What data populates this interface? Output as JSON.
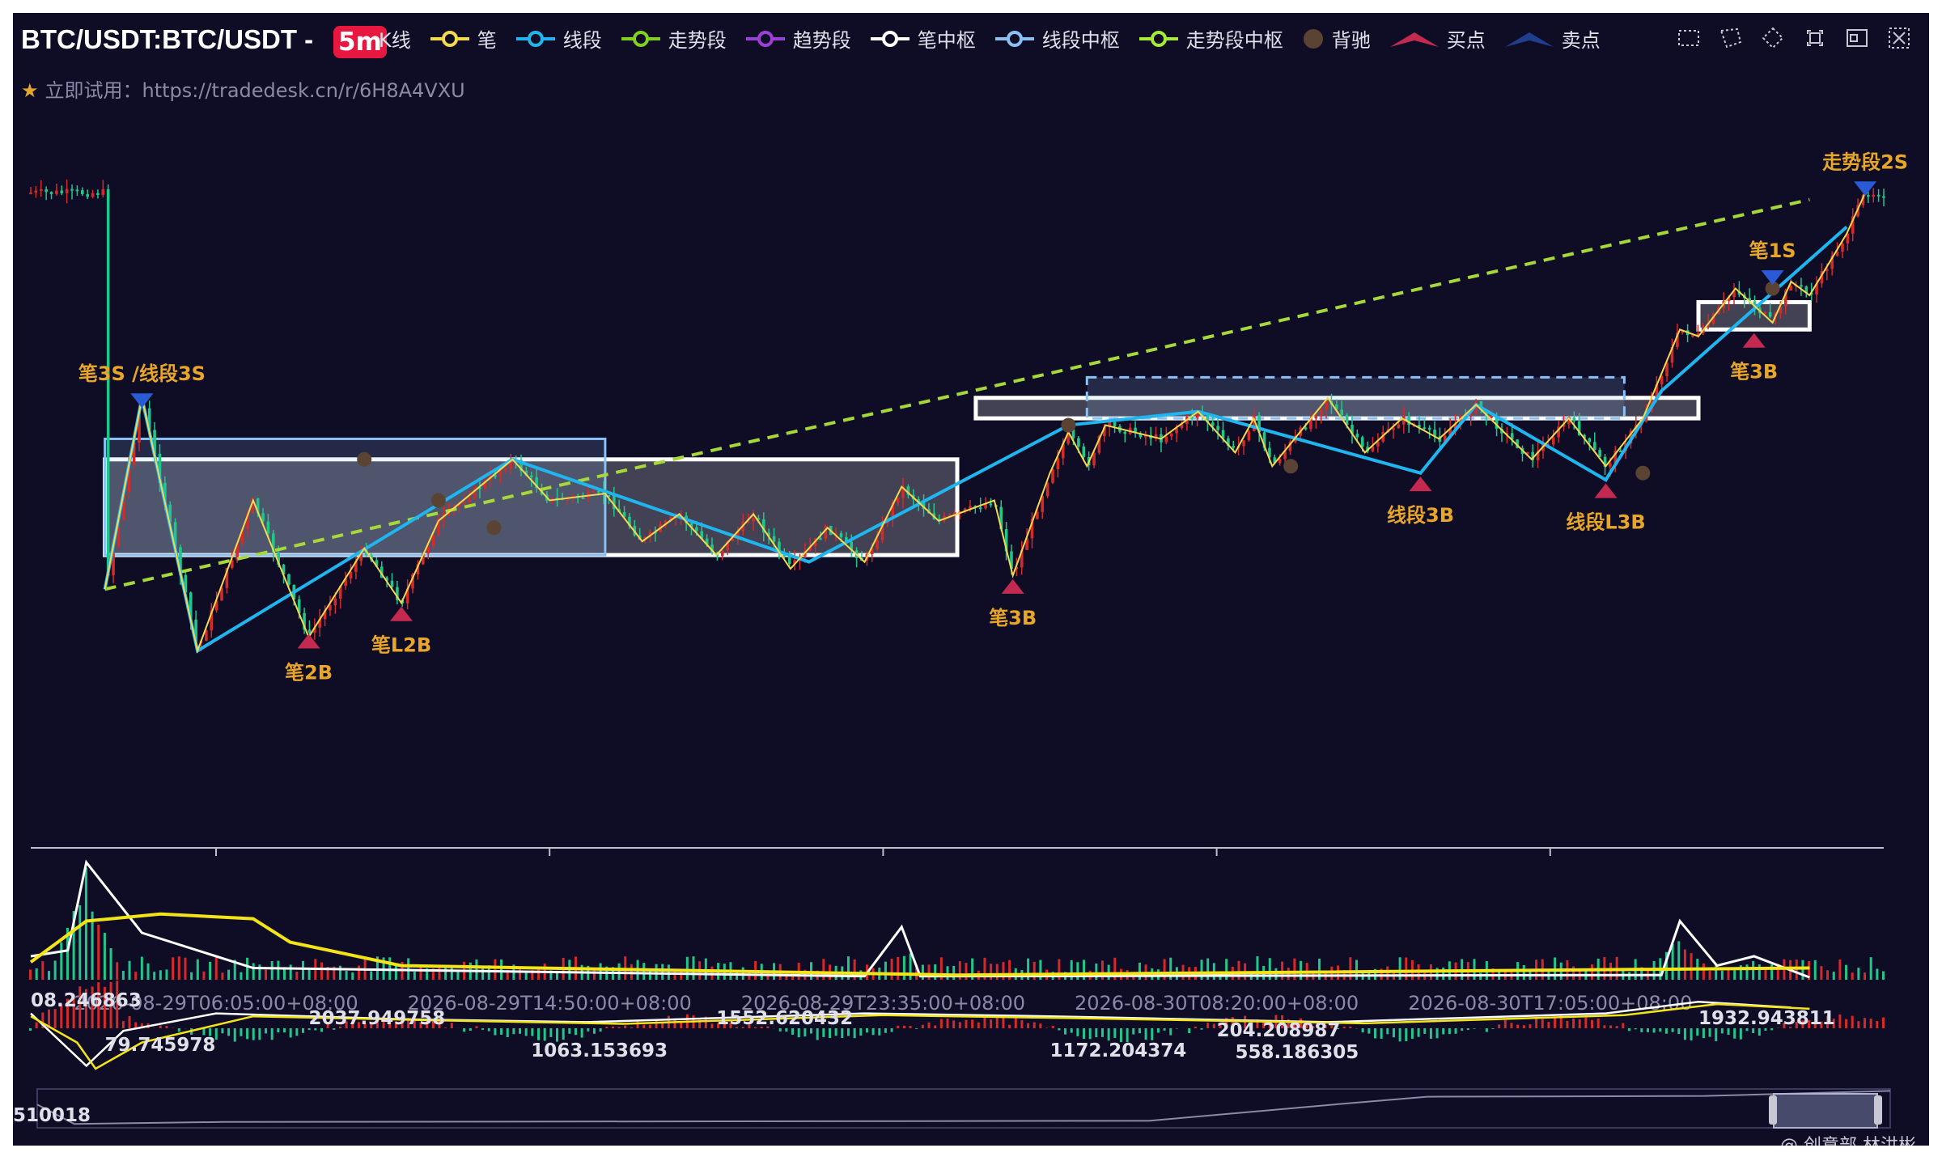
{
  "header": {
    "title": "BTC/USDT:BTC/USDT - ",
    "timeframe": "5m",
    "trial_text": "立即试用：https://tradedesk.cn/r/6H8A4VXU",
    "credit": "@ 创意部 林洪彬"
  },
  "legend": [
    {
      "label": "K线",
      "marker": "badge",
      "color": "#e8173f"
    },
    {
      "label": "笔",
      "marker": "line-dot",
      "color": "#f2d94e"
    },
    {
      "label": "线段",
      "marker": "line-dot",
      "color": "#1fb6f0"
    },
    {
      "label": "走势段",
      "marker": "line-dot",
      "color": "#7ed321"
    },
    {
      "label": "趋势段",
      "marker": "line-dot",
      "color": "#9b3fd8"
    },
    {
      "label": "笔中枢",
      "marker": "line-dot",
      "color": "#ffffff"
    },
    {
      "label": "线段中枢",
      "marker": "line-dot",
      "color": "#8cc0f5"
    },
    {
      "label": "走势段中枢",
      "marker": "line-dot",
      "color": "#a6ea3a"
    },
    {
      "label": "背驰",
      "marker": "dot",
      "color": "#5a4332"
    },
    {
      "label": "买点",
      "marker": "tri-up",
      "color": "#c42a4f"
    },
    {
      "label": "卖点",
      "marker": "tri-up",
      "color": "#1f3f8c"
    }
  ],
  "toolbar": [
    {
      "name": "rect-zoom-icon"
    },
    {
      "name": "lasso-select-icon"
    },
    {
      "name": "restore-icon"
    },
    {
      "name": "fullscreen-icon"
    },
    {
      "name": "save-image-icon"
    },
    {
      "name": "clear-icon"
    }
  ],
  "chart_data": {
    "type": "candlestick",
    "x_ticks": [
      "2026-08-29T06:05:00+08:00",
      "2026-08-29T14:50:00+08:00",
      "2026-08-29T23:35:00+08:00",
      "2026-08-30T08:20:00+08:00",
      "2026-08-30T17:05:00+08:00"
    ],
    "colors": {
      "up": "#d42a2a",
      "down": "#21c78a",
      "bi": "#f2d94e",
      "segment": "#1fb6f0",
      "trend": "#a6d83a",
      "bi_zone": "#ffffff",
      "seg_zone": "#8cc0f5",
      "buy": "#c42a4f",
      "sell": "#1f3f8c",
      "label": "#e7a62a"
    },
    "bi_path": [
      [
        0.04,
        0.63
      ],
      [
        0.06,
        0.35
      ],
      [
        0.09,
        0.72
      ],
      [
        0.12,
        0.5
      ],
      [
        0.15,
        0.7
      ],
      [
        0.18,
        0.57
      ],
      [
        0.2,
        0.65
      ],
      [
        0.22,
        0.53
      ],
      [
        0.26,
        0.44
      ],
      [
        0.28,
        0.5
      ],
      [
        0.31,
        0.49
      ],
      [
        0.33,
        0.56
      ],
      [
        0.35,
        0.52
      ],
      [
        0.37,
        0.58
      ],
      [
        0.39,
        0.52
      ],
      [
        0.41,
        0.6
      ],
      [
        0.43,
        0.54
      ],
      [
        0.45,
        0.59
      ],
      [
        0.47,
        0.48
      ],
      [
        0.49,
        0.53
      ],
      [
        0.52,
        0.5
      ],
      [
        0.53,
        0.61
      ],
      [
        0.55,
        0.46
      ],
      [
        0.56,
        0.4
      ],
      [
        0.57,
        0.45
      ],
      [
        0.58,
        0.39
      ],
      [
        0.61,
        0.41
      ],
      [
        0.63,
        0.37
      ],
      [
        0.65,
        0.43
      ],
      [
        0.66,
        0.38
      ],
      [
        0.67,
        0.45
      ],
      [
        0.7,
        0.35
      ],
      [
        0.72,
        0.43
      ],
      [
        0.74,
        0.38
      ],
      [
        0.76,
        0.41
      ],
      [
        0.78,
        0.36
      ],
      [
        0.81,
        0.44
      ],
      [
        0.83,
        0.38
      ],
      [
        0.85,
        0.45
      ],
      [
        0.87,
        0.38
      ],
      [
        0.89,
        0.25
      ],
      [
        0.9,
        0.26
      ],
      [
        0.92,
        0.19
      ],
      [
        0.94,
        0.24
      ],
      [
        0.95,
        0.18
      ],
      [
        0.96,
        0.2
      ],
      [
        0.98,
        0.11
      ],
      [
        0.99,
        0.05
      ]
    ],
    "segment_path": [
      [
        0.04,
        0.63
      ],
      [
        0.06,
        0.35
      ],
      [
        0.09,
        0.72
      ],
      [
        0.26,
        0.44
      ],
      [
        0.42,
        0.59
      ],
      [
        0.56,
        0.39
      ],
      [
        0.63,
        0.37
      ],
      [
        0.75,
        0.46
      ],
      [
        0.78,
        0.36
      ],
      [
        0.85,
        0.47
      ],
      [
        0.88,
        0.34
      ],
      [
        0.98,
        0.1
      ]
    ],
    "trend_line": [
      [
        0.04,
        0.63
      ],
      [
        0.96,
        0.06
      ]
    ],
    "bi_zones": [
      {
        "x0": 0.04,
        "x1": 0.5,
        "y_top": 0.44,
        "y_bot": 0.58
      },
      {
        "x0": 0.51,
        "x1": 0.9,
        "y_top": 0.35,
        "y_bot": 0.38
      },
      {
        "x0": 0.9,
        "x1": 0.96,
        "y_top": 0.21,
        "y_bot": 0.25
      }
    ],
    "seg_zones": [
      {
        "x0": 0.04,
        "x1": 0.31,
        "y_top": 0.41,
        "y_bot": 0.58
      },
      {
        "x0": 0.57,
        "x1": 0.86,
        "y_top": 0.32,
        "y_bot": 0.38
      }
    ],
    "trend_zones": [],
    "signals": [
      {
        "label": "笔3S /线段3S",
        "kind": "sell",
        "x": 0.06,
        "y": 0.36
      },
      {
        "label": "笔2B",
        "kind": "buy",
        "x": 0.15,
        "y": 0.7
      },
      {
        "label": "笔L2B",
        "kind": "buy",
        "x": 0.2,
        "y": 0.66
      },
      {
        "label": "笔3B",
        "kind": "buy",
        "x": 0.53,
        "y": 0.62
      },
      {
        "label": "线段3B",
        "kind": "buy",
        "x": 0.75,
        "y": 0.47
      },
      {
        "label": "线段L3B",
        "kind": "buy",
        "x": 0.85,
        "y": 0.48
      },
      {
        "label": "笔3B",
        "kind": "buy",
        "x": 0.93,
        "y": 0.26
      },
      {
        "label": "笔1S",
        "kind": "sell",
        "x": 0.94,
        "y": 0.18
      },
      {
        "label": "走势段2S",
        "kind": "sell",
        "x": 0.99,
        "y": 0.05
      }
    ],
    "divergence_points": [
      [
        0.18,
        0.44
      ],
      [
        0.22,
        0.5
      ],
      [
        0.25,
        0.54
      ],
      [
        0.56,
        0.39
      ],
      [
        0.68,
        0.45
      ],
      [
        0.87,
        0.46
      ],
      [
        0.94,
        0.19
      ]
    ],
    "volume_panel": {
      "peaks": [
        [
          0.03,
          1.0
        ],
        [
          0.47,
          0.3
        ],
        [
          0.89,
          0.42
        ],
        [
          0.93,
          0.15
        ]
      ]
    },
    "macd_panel": {
      "labels": [
        "08.246863",
        "79.745978",
        "2037.949758",
        "1063.153693",
        "1552.620432",
        "1172.204374",
        "204.208987",
        "558.186305",
        "1932.943811"
      ]
    },
    "navigator_label": "510018"
  }
}
